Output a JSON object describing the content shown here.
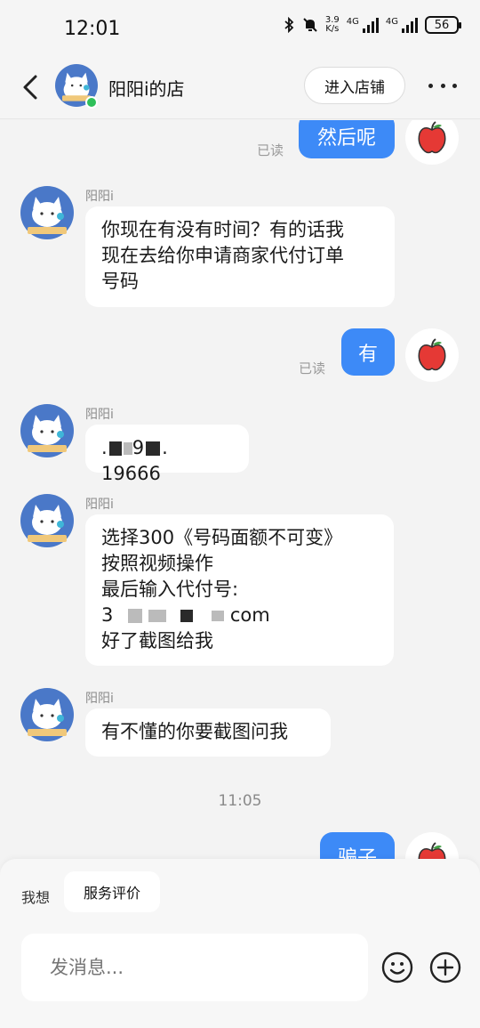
{
  "status": {
    "time": "12:01",
    "speed_value": "3.9",
    "speed_unit": "K/s",
    "net1": "4G",
    "net2": "4G",
    "battery": "56"
  },
  "header": {
    "title": "阳阳i的店",
    "enter_shop": "进入店铺"
  },
  "messages": {
    "m1_text": "然后呢",
    "m1_read": "已读",
    "sender": "阳阳i",
    "m2_l1": "你现在有没有时间？有的话我",
    "m2_l2": "现在去给你申请商家代付订单",
    "m2_l3": "号码",
    "m3_text": "有",
    "m3_read": "已读",
    "m4_a": ".",
    "m4_b": "9",
    "m4_c": ". 19666",
    "m5_l1": "选择300《号码面额不可变》",
    "m5_l2": "按照视频操作",
    "m5_l3": "最后输入代付号:",
    "m5_l4_a": "3",
    "m5_l4_b": "com",
    "m5_l5": "好了截图给我",
    "m6_text": "有不懂的你要截图问我",
    "time_sep": "11:05",
    "m7_text": "骗子"
  },
  "bottom": {
    "want": "我想",
    "service": "服务评价",
    "placeholder": "发消息..."
  }
}
